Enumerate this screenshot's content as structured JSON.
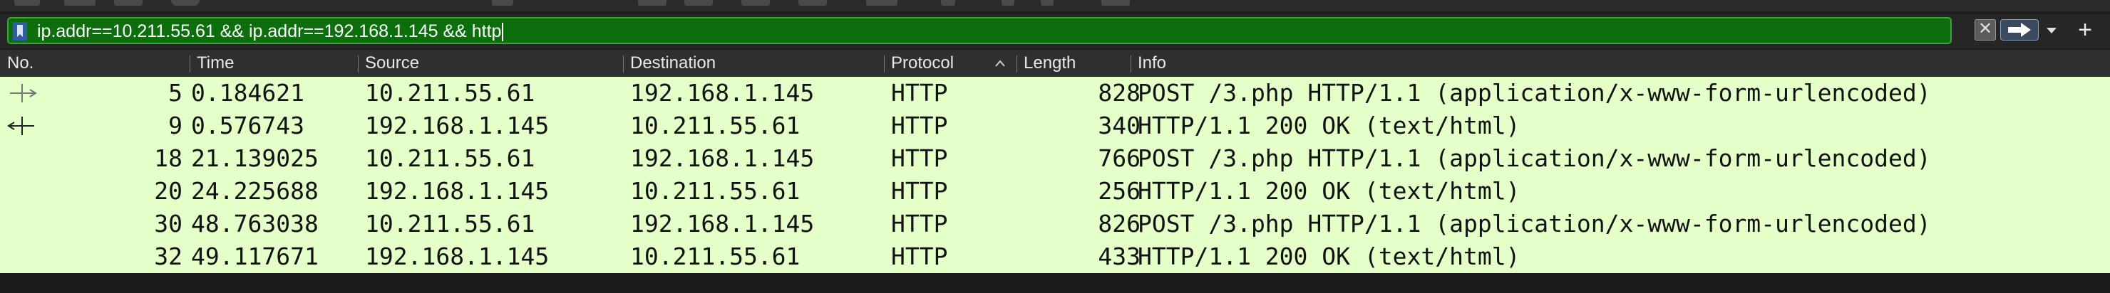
{
  "filter": {
    "value": "ip.addr==10.211.55.61 && ip.addr==192.168.1.145 && http",
    "background": "#0d6e0d"
  },
  "icons": {
    "bookmark": "bookmark-icon",
    "clear": "clear-icon",
    "apply": "arrow-right-icon",
    "dropdown": "chevron-down-icon",
    "add": "plus-icon"
  },
  "filter_buttons": {
    "clear_glyph": "✕",
    "add_glyph": "+"
  },
  "columns": [
    "No.",
    "Time",
    "Source",
    "Destination",
    "Protocol",
    "Length",
    "Info"
  ],
  "row_color": "#e4ffc7",
  "packets": [
    {
      "no": "5",
      "time": "0.184621",
      "source": "10.211.55.61",
      "destination": "192.168.1.145",
      "protocol": "HTTP",
      "length": "828",
      "info": "POST /3.php HTTP/1.1  (application/x-www-form-urlencoded)"
    },
    {
      "no": "9",
      "time": "0.576743",
      "source": "192.168.1.145",
      "destination": "10.211.55.61",
      "protocol": "HTTP",
      "length": "340",
      "info": "HTTP/1.1 200 OK  (text/html)"
    },
    {
      "no": "18",
      "time": "21.139025",
      "source": "10.211.55.61",
      "destination": "192.168.1.145",
      "protocol": "HTTP",
      "length": "766",
      "info": "POST /3.php HTTP/1.1  (application/x-www-form-urlencoded)"
    },
    {
      "no": "20",
      "time": "24.225688",
      "source": "192.168.1.145",
      "destination": "10.211.55.61",
      "protocol": "HTTP",
      "length": "256",
      "info": "HTTP/1.1 200 OK  (text/html)"
    },
    {
      "no": "30",
      "time": "48.763038",
      "source": "10.211.55.61",
      "destination": "192.168.1.145",
      "protocol": "HTTP",
      "length": "826",
      "info": "POST /3.php HTTP/1.1  (application/x-www-form-urlencoded)"
    },
    {
      "no": "32",
      "time": "49.117671",
      "source": "192.168.1.145",
      "destination": "10.211.55.61",
      "protocol": "HTTP",
      "length": "433",
      "info": "HTTP/1.1 200 OK  (text/html)"
    }
  ]
}
